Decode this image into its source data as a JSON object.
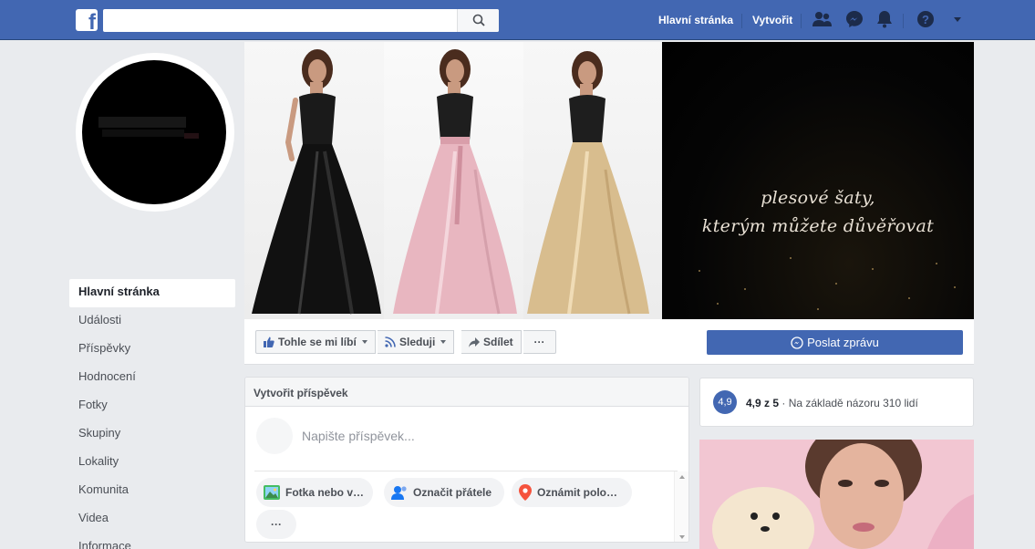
{
  "topbar": {
    "search": {
      "placeholder": "",
      "value": ""
    },
    "nav": {
      "home_label": "Hlavní stránka",
      "create_label": "Vytvořit"
    },
    "icons": [
      "facebook-logo-icon",
      "search-icon",
      "friends-icon",
      "messenger-icon",
      "notifications-icon",
      "help-icon",
      "account-menu-caret-icon"
    ]
  },
  "sidebar": {
    "items": [
      {
        "label": "Hlavní stránka",
        "active": true
      },
      {
        "label": "Události"
      },
      {
        "label": "Příspěvky"
      },
      {
        "label": "Hodnocení"
      },
      {
        "label": "Fotky"
      },
      {
        "label": "Skupiny"
      },
      {
        "label": "Lokality"
      },
      {
        "label": "Komunita"
      },
      {
        "label": "Videa"
      },
      {
        "label": "Informace"
      }
    ]
  },
  "cover": {
    "tagline_line1": "plesové šaty,",
    "tagline_line2": "kterým můžete důvěřovat",
    "dress_colors": [
      "#141414",
      "#e8b6c0",
      "#d8bd8e"
    ]
  },
  "actions": {
    "like_label": "Tohle se mi líbí",
    "follow_label": "Sleduji",
    "share_label": "Sdílet",
    "more_label": "···",
    "message_label": "Poslat zprávu"
  },
  "composer": {
    "title": "Vytvořit příspěvek",
    "placeholder": "Napište příspěvek...",
    "chips": {
      "photo": "Fotka nebo v…",
      "tag": "Označit přátele",
      "feeling": "Oznámit polo…",
      "more": "···"
    }
  },
  "rating": {
    "badge": "4,9",
    "score": "4,9 z 5",
    "text": " · Na základě názoru 310 lidí"
  },
  "colors": {
    "brand": "#4267b2",
    "background": "#e9ebee",
    "card": "#ffffff"
  }
}
